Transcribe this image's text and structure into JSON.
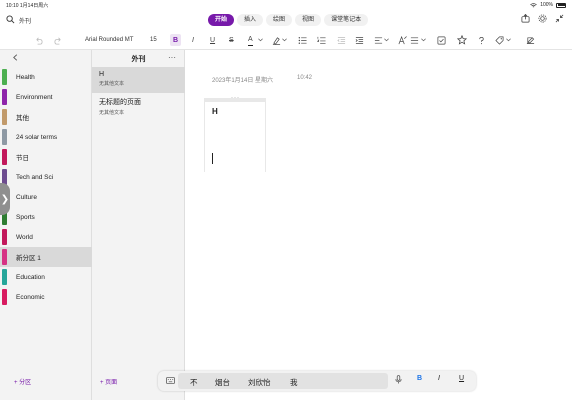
{
  "status_bar": {
    "time": "10:10 1月14日周六",
    "battery": "100%"
  },
  "header": {
    "notebook_title": "外刊",
    "tabs": [
      {
        "label": "开始",
        "active": true
      },
      {
        "label": "插入",
        "active": false
      },
      {
        "label": "绘图",
        "active": false
      },
      {
        "label": "视图",
        "active": false
      },
      {
        "label": "课堂笔记本",
        "active": false
      }
    ],
    "icons": [
      "search-icon",
      "share-icon",
      "settings-icon",
      "collapse-icon"
    ]
  },
  "toolbar": {
    "font_name": "Arial Rounded MT",
    "font_size": "15",
    "bold": "B",
    "italic": "I",
    "underline": "U",
    "strike": "S",
    "font_color": "A"
  },
  "sections_pane": {
    "sections": [
      {
        "label": "Health",
        "color": "#4caf50",
        "selected": false
      },
      {
        "label": "Environment",
        "color": "#8e24aa",
        "selected": false
      },
      {
        "label": "其他",
        "color": "#c19a6b",
        "selected": false
      },
      {
        "label": "24 solar terms",
        "color": "#8e99a4",
        "selected": false
      },
      {
        "label": "节日",
        "color": "#c2185b",
        "selected": false
      },
      {
        "label": "Tech and Sci",
        "color": "#6d4c8f",
        "selected": false
      },
      {
        "label": "Culture",
        "color": "#e67e22",
        "selected": false
      },
      {
        "label": "Sports",
        "color": "#2e7d32",
        "selected": false
      },
      {
        "label": "World",
        "color": "#c2185b",
        "selected": false
      },
      {
        "label": "新分区 1",
        "color": "#d63384",
        "selected": true
      },
      {
        "label": "Education",
        "color": "#26a69a",
        "selected": false
      },
      {
        "label": "Economic",
        "color": "#d81b60",
        "selected": false
      }
    ],
    "add_label": "+ 分区"
  },
  "pages_pane": {
    "title": "外刊",
    "pages": [
      {
        "title": "H",
        "subtitle": "无其他文本",
        "selected": true
      },
      {
        "title": "无标题的页面",
        "subtitle": "无其他文本",
        "selected": false
      }
    ],
    "add_label": "+ 页面"
  },
  "canvas": {
    "date": "2023年1月14日 星期六",
    "time": "10:42",
    "note_text": "H"
  },
  "keyboard_bar": {
    "candidates": [
      "不",
      "烟台",
      "刘欣怡",
      "我"
    ],
    "format": [
      "B",
      "I",
      "U"
    ]
  }
}
